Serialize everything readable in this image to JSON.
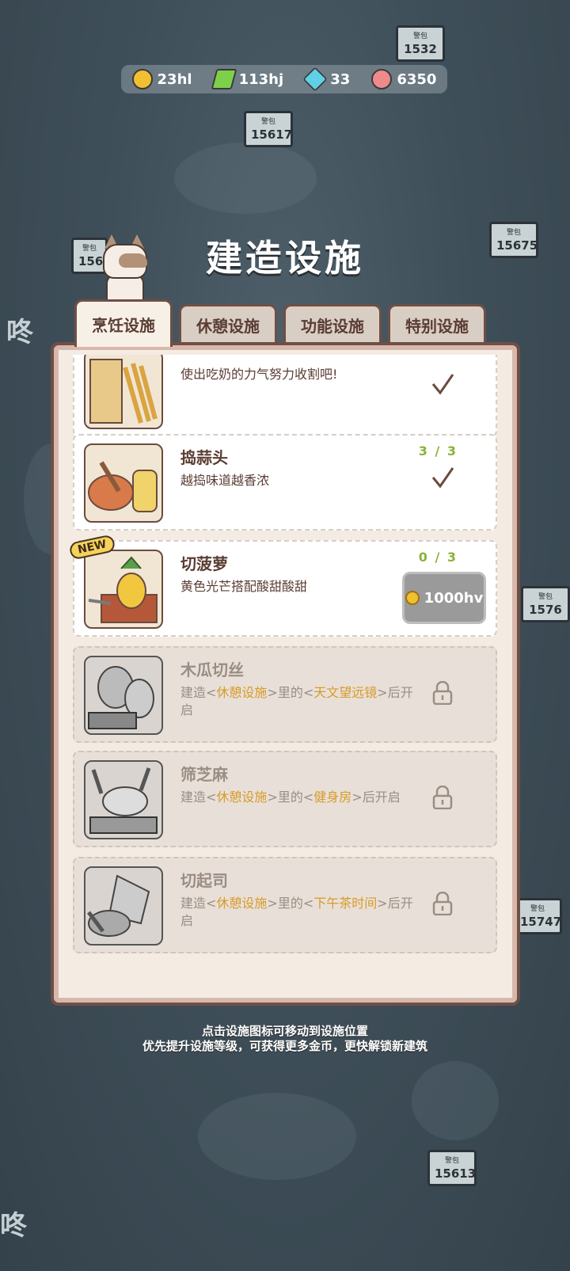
{
  "resources": [
    {
      "name": "coin",
      "value": "23hl",
      "color": "#f0c030",
      "icon": "coin-icon"
    },
    {
      "name": "energy",
      "value": "113hj",
      "color": "#7ed04a",
      "icon": "lightning-icon"
    },
    {
      "name": "gem",
      "value": "33",
      "color": "#5fd0e8",
      "icon": "diamond-icon"
    },
    {
      "name": "shell",
      "value": "6350",
      "color": "#f08a8a",
      "icon": "shell-icon"
    }
  ],
  "title": "建造设施",
  "tabs": [
    {
      "label": "烹饪设施",
      "active": true
    },
    {
      "label": "休憩设施",
      "active": false
    },
    {
      "label": "功能设施",
      "active": false
    },
    {
      "label": "特别设施",
      "active": false
    }
  ],
  "facilities": [
    {
      "name": "",
      "desc": "使出吃奶的力气努力收割吧!",
      "status": "done"
    },
    {
      "name": "捣蒜头",
      "progress": "3 / 3",
      "desc": "越捣味道越香浓",
      "status": "done"
    },
    {
      "name": "切菠萝",
      "progress": "0 / 3",
      "desc": "黄色光芒搭配酸甜酸甜",
      "badge": "NEW",
      "price": "1000hv",
      "status": "buy"
    },
    {
      "name": "木瓜切丝",
      "desc_parts": [
        "建造<",
        "休憩设施",
        ">里的<",
        "天文望远镜",
        ">后开启"
      ],
      "status": "locked"
    },
    {
      "name": "筛芝麻",
      "desc_parts": [
        "建造<",
        "休憩设施",
        ">里的<",
        "健身房",
        ">后开启"
      ],
      "status": "locked"
    },
    {
      "name": "切起司",
      "desc_parts": [
        "建造<",
        "休憩设施",
        ">里的<",
        "下午茶时间",
        ">后开启"
      ],
      "status": "locked"
    }
  ],
  "signs": [
    "1532",
    "15617",
    "15675",
    "1569",
    "1576",
    "15747",
    "15613"
  ],
  "side_glyph": "咚",
  "hint": {
    "line1": "点击设施图标可移动到设施位置",
    "line2": "优先提升设施等级，可获得更多金币，更快解锁新建筑"
  }
}
